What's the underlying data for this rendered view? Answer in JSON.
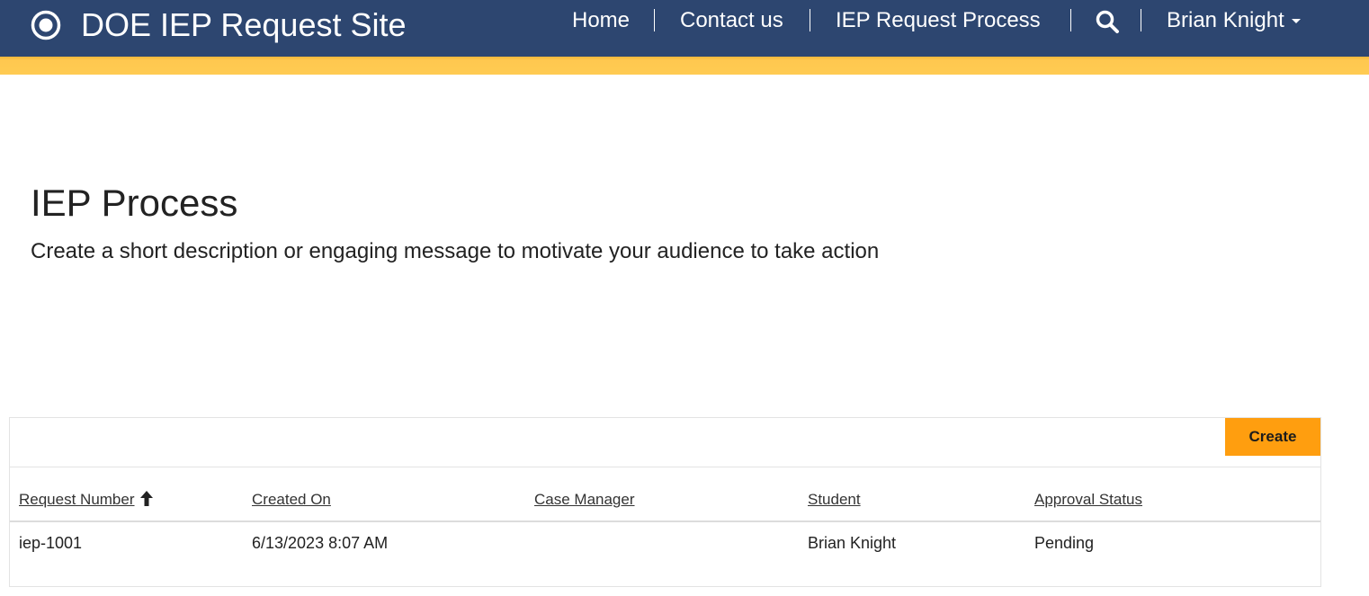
{
  "header": {
    "brand_title": "DOE IEP Request Site",
    "nav_items": [
      "Home",
      "Contact us",
      "IEP Request Process"
    ],
    "user_name": "Brian Knight",
    "search_icon": "search-icon",
    "brand_icon": "portal-logo-icon",
    "navbar_color": "#2d4670",
    "accent_color": "#ffcb52"
  },
  "main": {
    "title": "IEP Process",
    "subtitle": "Create a short description or engaging message to motivate your audience to take action"
  },
  "list": {
    "create_label": "Create",
    "create_color": "#ff9e0f",
    "columns": [
      "Request Number",
      "Created On",
      "Case Manager",
      "Student",
      "Approval Status"
    ],
    "sort_icon": "sort-ascending-icon",
    "rows": [
      {
        "request_number": "iep-1001",
        "created_on": "6/13/2023 8:07 AM",
        "case_manager": "",
        "student": "Brian Knight",
        "approval_status": "Pending"
      }
    ]
  }
}
